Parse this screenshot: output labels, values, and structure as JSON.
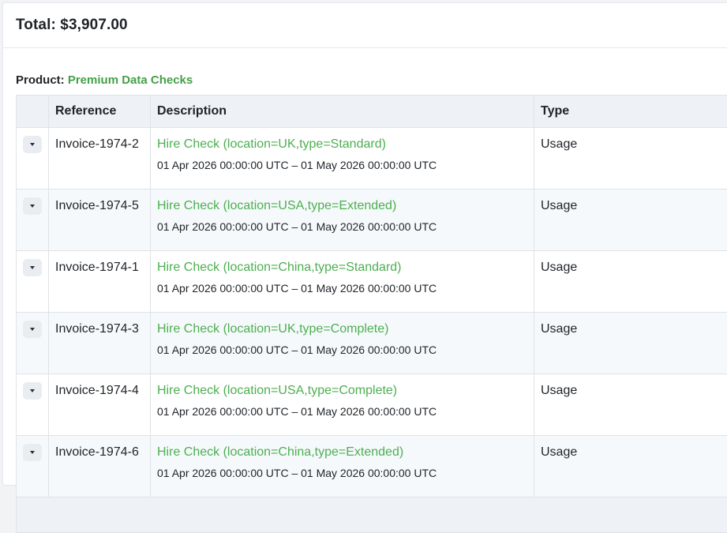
{
  "header": {
    "total_label": "Total: $3,907.00"
  },
  "product": {
    "label": "Product:",
    "name": "Premium Data Checks"
  },
  "table": {
    "columns": {
      "reference": "Reference",
      "description": "Description",
      "type": "Type"
    },
    "rows": [
      {
        "reference": "Invoice-1974-2",
        "description": "Hire Check (location=UK,type=Standard)",
        "period": "01 Apr 2026 00:00:00 UTC – 01 May 2026 00:00:00 UTC",
        "type": "Usage"
      },
      {
        "reference": "Invoice-1974-5",
        "description": "Hire Check (location=USA,type=Extended)",
        "period": "01 Apr 2026 00:00:00 UTC – 01 May 2026 00:00:00 UTC",
        "type": "Usage"
      },
      {
        "reference": "Invoice-1974-1",
        "description": "Hire Check (location=China,type=Standard)",
        "period": "01 Apr 2026 00:00:00 UTC – 01 May 2026 00:00:00 UTC",
        "type": "Usage"
      },
      {
        "reference": "Invoice-1974-3",
        "description": "Hire Check (location=UK,type=Complete)",
        "period": "01 Apr 2026 00:00:00 UTC – 01 May 2026 00:00:00 UTC",
        "type": "Usage"
      },
      {
        "reference": "Invoice-1974-4",
        "description": "Hire Check (location=USA,type=Complete)",
        "period": "01 Apr 2026 00:00:00 UTC – 01 May 2026 00:00:00 UTC",
        "type": "Usage"
      },
      {
        "reference": "Invoice-1974-6",
        "description": "Hire Check (location=China,type=Extended)",
        "period": "01 Apr 2026 00:00:00 UTC – 01 May 2026 00:00:00 UTC",
        "type": "Usage"
      }
    ],
    "row_toggle_icon": "caret-down-icon"
  },
  "colors": {
    "accent_green": "#4caf50",
    "header_bg": "#eef2f6"
  }
}
